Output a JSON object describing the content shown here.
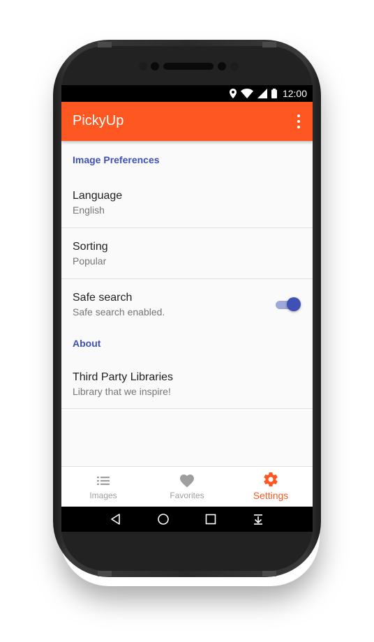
{
  "status_bar": {
    "time": "12:00"
  },
  "app_bar": {
    "title": "PickyUp",
    "menu_icon": "more-vert-icon"
  },
  "sections": {
    "image_preferences": {
      "header": "Image Preferences",
      "language": {
        "title": "Language",
        "summary": "English"
      },
      "sorting": {
        "title": "Sorting",
        "summary": "Popular"
      },
      "safe_search": {
        "title": "Safe search",
        "summary": "Safe search enabled.",
        "enabled": true
      }
    },
    "about": {
      "header": "About",
      "third_party": {
        "title": "Third Party Libraries",
        "summary": "Library that we inspire!"
      }
    }
  },
  "bottom_nav": {
    "images": {
      "label": "Images",
      "icon": "list-icon"
    },
    "favorites": {
      "label": "Favorites",
      "icon": "heart-icon"
    },
    "settings": {
      "label": "Settings",
      "icon": "gear-icon",
      "active": true
    }
  },
  "colors": {
    "primary": "#ff5722",
    "accent": "#3f51b5",
    "accent_light": "#9fa8da"
  }
}
